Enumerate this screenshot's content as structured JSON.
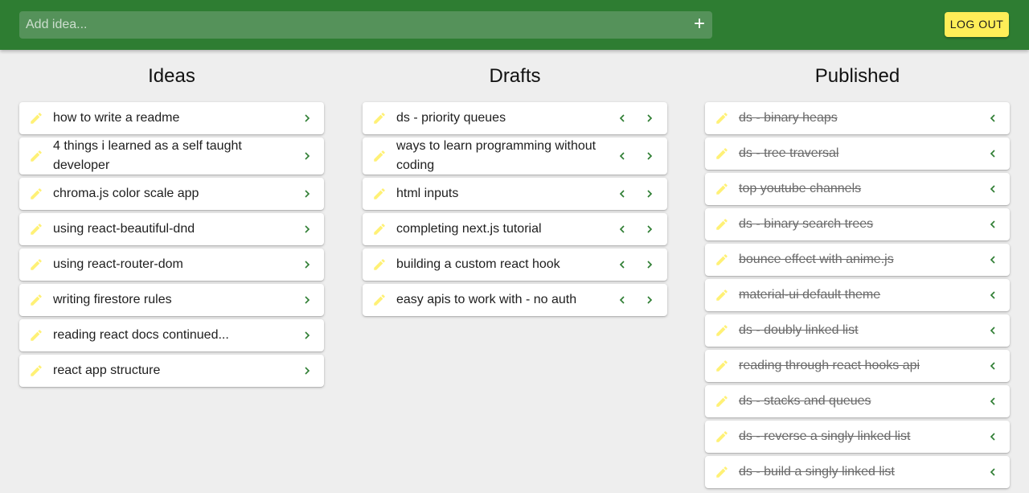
{
  "header": {
    "add_placeholder": "Add idea...",
    "add_button_icon": "plus-icon",
    "logout_label": "LOG OUT"
  },
  "colors": {
    "appbar": "#2e7d32",
    "accent": "#ffee58",
    "pencil": "#fff176",
    "chevron": "#2e7d32"
  },
  "columns": {
    "ideas": {
      "title": "Ideas",
      "items": [
        "how to write a readme",
        "4 things i learned as a self taught developer",
        "chroma.js color scale app",
        "using react-beautiful-dnd",
        "using react-router-dom",
        "writing firestore rules",
        "reading react docs continued...",
        "react app structure"
      ]
    },
    "drafts": {
      "title": "Drafts",
      "items": [
        "ds - priority queues",
        "ways to learn programming without coding",
        "html inputs",
        "completing next.js tutorial",
        "building a custom react hook",
        "easy apis to work with - no auth"
      ]
    },
    "published": {
      "title": "Published",
      "items": [
        "ds - binary heaps",
        "ds - tree traversal",
        "top youtube channels",
        "ds - binary search trees",
        "bounce effect with anime.js",
        "material-ui default theme",
        "ds - doubly linked list",
        "reading through react hooks api",
        "ds - stacks and queues",
        "ds - reverse a singly linked list",
        "ds - build a singly linked list"
      ]
    }
  }
}
